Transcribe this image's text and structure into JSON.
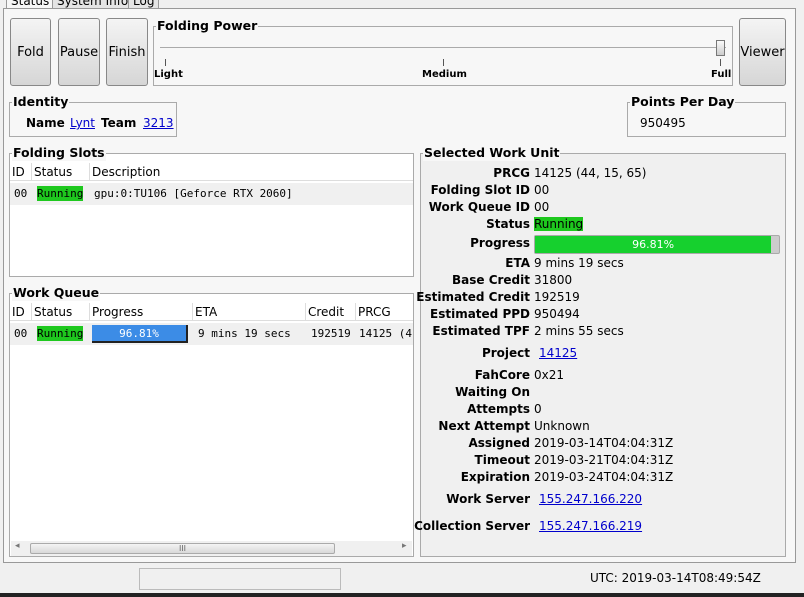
{
  "tabs": [
    "Status",
    "System Info",
    "Log"
  ],
  "buttons": {
    "fold": "Fold",
    "pause": "Pause",
    "finish": "Finish",
    "viewer": "Viewer"
  },
  "folding_power": {
    "title": "Folding Power",
    "ticks": [
      "Light",
      "Medium",
      "Full"
    ],
    "value": "Full"
  },
  "identity": {
    "title": "Identity",
    "name_label": "Name",
    "name": "Lynt",
    "team_label": "Team",
    "team": "3213"
  },
  "ppd": {
    "title": "Points Per Day",
    "value": "950495"
  },
  "folding_slots": {
    "title": "Folding Slots",
    "columns": [
      "ID",
      "Status",
      "Description"
    ],
    "rows": [
      {
        "id": "00",
        "status": "Running",
        "description": "gpu:0:TU106 [Geforce RTX 2060]"
      }
    ]
  },
  "work_queue": {
    "title": "Work Queue",
    "columns": [
      "ID",
      "Status",
      "Progress",
      "ETA",
      "Credit",
      "PRCG"
    ],
    "rows": [
      {
        "id": "00",
        "status": "Running",
        "progress": "96.81%",
        "progress_value": 96.81,
        "eta": "9 mins 19 secs",
        "credit": "192519",
        "prcg": "14125 (4"
      }
    ]
  },
  "selected_work_unit": {
    "title": "Selected Work Unit",
    "fields": [
      {
        "label": "PRCG",
        "value": "14125 (44, 15, 65)"
      },
      {
        "label": "Folding Slot ID",
        "value": "00"
      },
      {
        "label": "Work Queue ID",
        "value": "00"
      },
      {
        "label": "Status",
        "value": "Running"
      },
      {
        "label": "Progress",
        "value": "96.81%"
      },
      {
        "label": "ETA",
        "value": "9 mins 19 secs"
      },
      {
        "label": "Base Credit",
        "value": "31800"
      },
      {
        "label": "Estimated Credit",
        "value": "192519"
      },
      {
        "label": "Estimated PPD",
        "value": "950494"
      },
      {
        "label": "Estimated TPF",
        "value": "2 mins 55 secs"
      },
      {
        "label": "Project",
        "value": "14125"
      },
      {
        "label": "FahCore",
        "value": "0x21"
      },
      {
        "label": "Waiting On",
        "value": ""
      },
      {
        "label": "Attempts",
        "value": "0"
      },
      {
        "label": "Next Attempt",
        "value": "Unknown"
      },
      {
        "label": "Assigned",
        "value": "2019-03-14T04:04:31Z"
      },
      {
        "label": "Timeout",
        "value": "2019-03-21T04:04:31Z"
      },
      {
        "label": "Expiration",
        "value": "2019-03-24T04:04:31Z"
      },
      {
        "label": "Work Server",
        "value": "155.247.166.220"
      },
      {
        "label": "Collection Server",
        "value": "155.247.166.219"
      }
    ],
    "progress_value": 96.81
  },
  "status_bar": {
    "utc": "UTC: 2019-03-14T08:49:54Z"
  },
  "colors": {
    "running": "#1ec81e",
    "progress_blue": "#3c8ce6",
    "link": "#0000cc"
  }
}
